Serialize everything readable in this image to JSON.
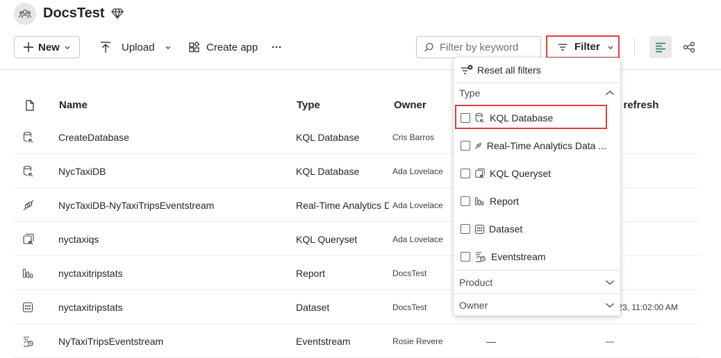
{
  "workspace": {
    "title": "DocsTest",
    "avatar_icon": "workspace-people-icon",
    "badge_icon": "premium-diamond-icon"
  },
  "toolbar": {
    "new_label": "New",
    "upload_label": "Upload",
    "create_app_label": "Create app",
    "more_label": "···",
    "search_placeholder": "Filter by keyword",
    "filter_label": "Filter"
  },
  "table": {
    "headers": {
      "name": "Name",
      "type": "Type",
      "owner": "Owner",
      "next_refresh": "xt refresh"
    },
    "rows": [
      {
        "icon": "kql-database-icon",
        "name": "CreateDatabase",
        "type": "KQL Database",
        "owner": "Cris Barros",
        "refreshed": "",
        "next": ""
      },
      {
        "icon": "kql-database-icon",
        "name": "NycTaxiDB",
        "type": "KQL Database",
        "owner": "Ada Lovelace",
        "refreshed": "",
        "next": ""
      },
      {
        "icon": "eventstream-link-icon",
        "name": "NycTaxiDB-NyTaxiTripsEventstream",
        "type": "Real-Time Analytics D",
        "owner": "Ada Lovelace",
        "refreshed": "",
        "next": ""
      },
      {
        "icon": "kql-queryset-icon",
        "name": "nyctaxiqs",
        "type": "KQL Queryset",
        "owner": "Ada Lovelace",
        "refreshed": "",
        "next": ""
      },
      {
        "icon": "report-icon",
        "name": "nyctaxitripstats",
        "type": "Report",
        "owner": "DocsTest",
        "refreshed": "",
        "next": ""
      },
      {
        "icon": "dataset-icon",
        "name": "nyctaxitripstats",
        "type": "Dataset",
        "owner": "DocsTest",
        "refreshed": "",
        "next": "/23, 11:02:00 AM"
      },
      {
        "icon": "eventstream-icon",
        "name": "NyTaxiTripsEventstream",
        "type": "Eventstream",
        "owner": "Rosie Revere",
        "refreshed": "—",
        "next": "—"
      }
    ]
  },
  "filter_menu": {
    "reset_label": "Reset all filters",
    "type_section": "Type",
    "type_options": [
      {
        "label": "KQL Database",
        "icon": "kql-database-icon",
        "checked": false
      },
      {
        "label": "Real-Time Analytics Data ...",
        "icon": "eventstream-link-icon",
        "checked": false
      },
      {
        "label": "KQL Queryset",
        "icon": "kql-queryset-icon",
        "checked": false
      },
      {
        "label": "Report",
        "icon": "report-icon",
        "checked": false
      },
      {
        "label": "Dataset",
        "icon": "dataset-icon",
        "checked": false
      },
      {
        "label": "Eventstream",
        "icon": "eventstream-icon",
        "checked": false
      }
    ],
    "product_section": "Product",
    "owner_section": "Owner"
  },
  "colors": {
    "highlight": "#e03c3c",
    "accent_green": "#117865",
    "text": "#242424"
  }
}
